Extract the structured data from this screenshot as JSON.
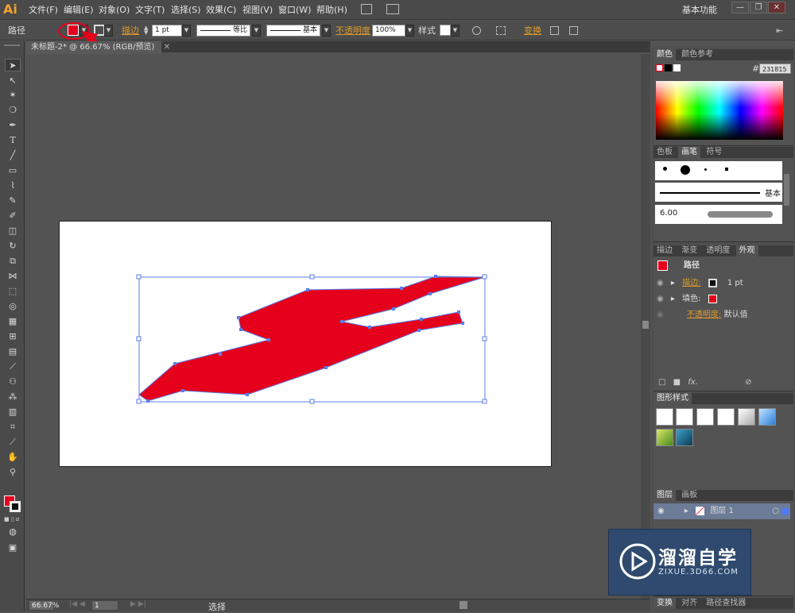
{
  "app": {
    "logo": "Ai",
    "workspace": "基本功能"
  },
  "menus": [
    "文件(F)",
    "编辑(E)",
    "对象(O)",
    "文字(T)",
    "选择(S)",
    "效果(C)",
    "视图(V)",
    "窗口(W)",
    "帮助(H)"
  ],
  "window_controls": {
    "minimize": "—",
    "restore": "❐",
    "close": "✕"
  },
  "control": {
    "object_type": "路径",
    "stroke_label": "描边",
    "stroke_weight": "1 pt",
    "profile_label": "等比",
    "brush_label": "基本",
    "opacity_label": "不透明度",
    "opacity_value": "100%",
    "style_label": "样式",
    "transform_label": "变换"
  },
  "document": {
    "tab_title": "未标题-2* @ 66.67% (RGB/预览)",
    "close": "✕"
  },
  "status": {
    "zoom": "66.67%",
    "page": "1",
    "tool": "选择"
  },
  "colors": {
    "fill": "#e5001c",
    "accent": "#e09a2a",
    "selection": "#5a7ee8"
  },
  "color_panel": {
    "tabs": [
      "颜色",
      "颜色参考"
    ],
    "hex_prefix": "#",
    "hex_value": "231815"
  },
  "brush_panel": {
    "tabs": [
      "色板",
      "画笔",
      "符号"
    ],
    "stroke_name": "基本",
    "size": "6.00"
  },
  "appearance_panel": {
    "tabs": [
      "描边",
      "渐变",
      "透明度",
      "外观"
    ],
    "title": "路径",
    "rows": [
      {
        "label": "描边:",
        "value": "1 pt"
      },
      {
        "label": "填色:",
        "value": ""
      },
      {
        "label": "不透明度:",
        "value": "默认值"
      }
    ],
    "fx": "fx."
  },
  "graphic_styles": {
    "title": "图形样式"
  },
  "layers_panel": {
    "tabs": [
      "图层",
      "画板"
    ],
    "layer_name": "图层 1"
  },
  "bottom_tabs": [
    "变换",
    "对齐",
    "路径查找器"
  ],
  "watermark": {
    "title": "溜溜自学",
    "subtitle": "ZIXUE.3D66.COM"
  }
}
